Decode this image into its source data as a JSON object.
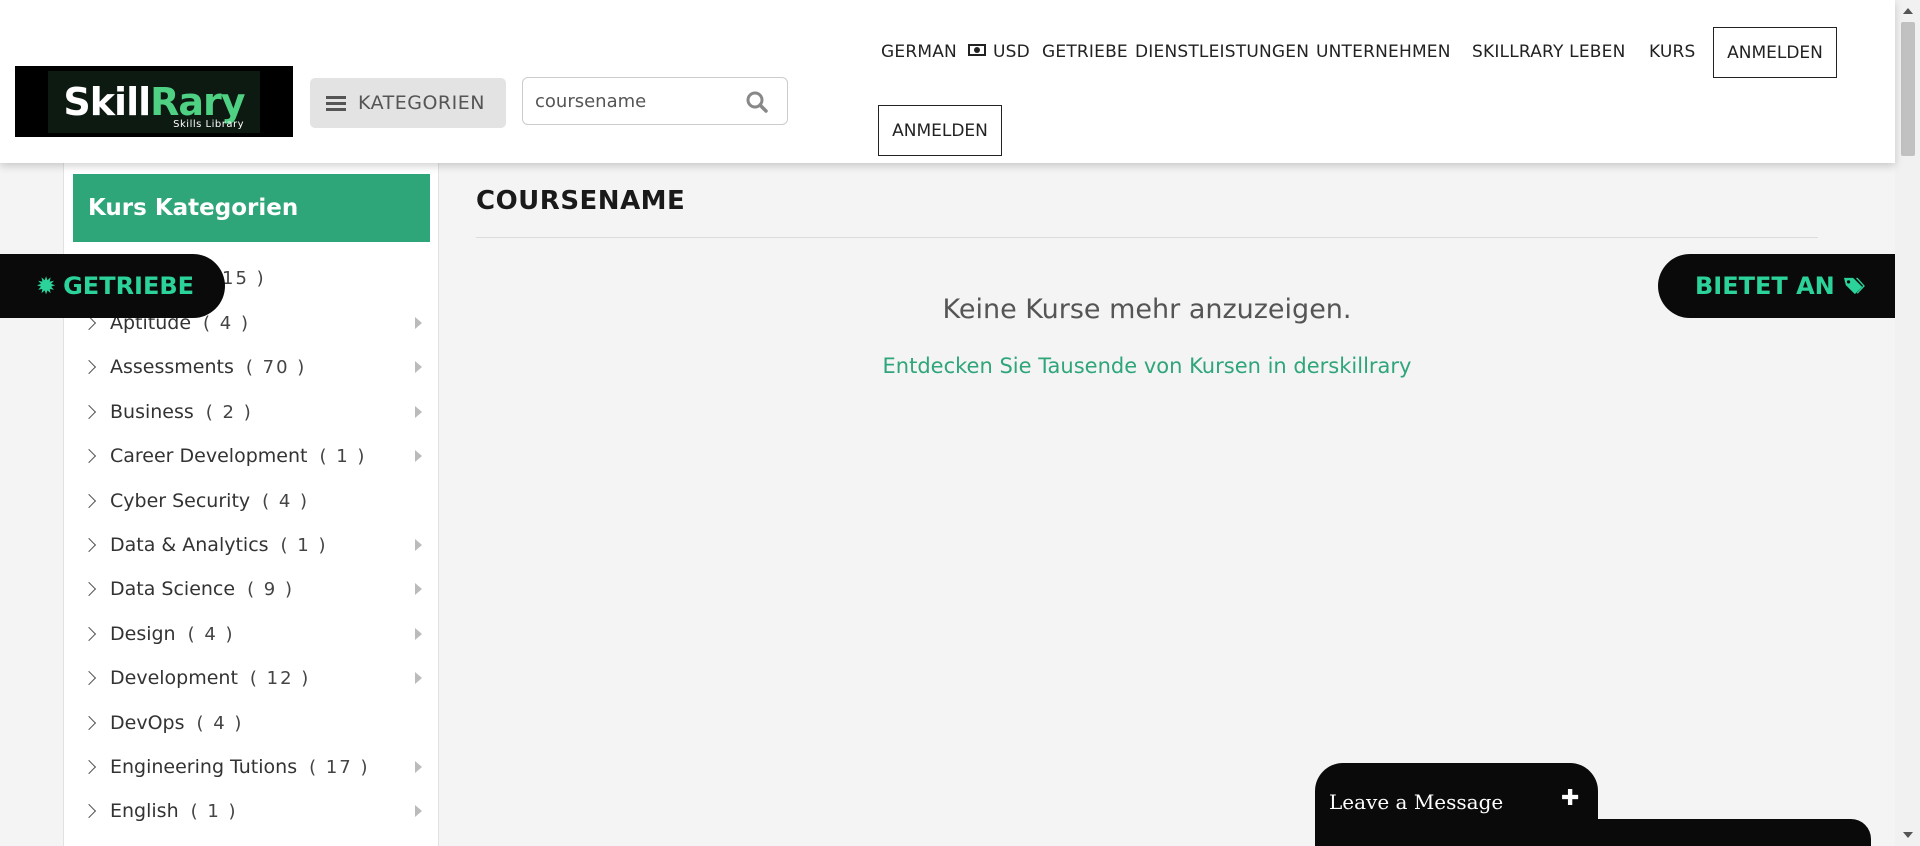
{
  "logo": {
    "text_main_1": "Skill",
    "text_main_2": "Rary",
    "subtitle": "Skills Library"
  },
  "header": {
    "categories_label": "KATEGORIEN",
    "search_value": "coursename",
    "nav": {
      "language": "GERMAN",
      "currency": "USD",
      "gear": "GETRIEBE",
      "services": "DIENSTLEISTUNGEN",
      "company": "UNTERNEHMEN",
      "live": "SKILLRARY LEBEN",
      "course": "KURS",
      "login": "ANMELDEN",
      "login_2": "ANMELDEN"
    }
  },
  "sidebar": {
    "title": "Kurs Kategorien",
    "partial_item_count": "15 )",
    "items": [
      {
        "label": "Aptitude",
        "count": "( 4 )",
        "has_sub": true
      },
      {
        "label": "Assessments",
        "count": "( 70 )",
        "has_sub": true
      },
      {
        "label": "Business",
        "count": "( 2 )",
        "has_sub": true
      },
      {
        "label": "Career Development",
        "count": "( 1 )",
        "has_sub": true
      },
      {
        "label": "Cyber Security",
        "count": "( 4 )",
        "has_sub": false
      },
      {
        "label": "Data & Analytics",
        "count": "( 1 )",
        "has_sub": true
      },
      {
        "label": "Data Science",
        "count": "( 9 )",
        "has_sub": true
      },
      {
        "label": "Design",
        "count": "( 4 )",
        "has_sub": true
      },
      {
        "label": "Development",
        "count": "( 12 )",
        "has_sub": true
      },
      {
        "label": "DevOps",
        "count": "( 4 )",
        "has_sub": false
      },
      {
        "label": "Engineering Tutions",
        "count": "( 17 )",
        "has_sub": true
      },
      {
        "label": "English",
        "count": "( 1 )",
        "has_sub": true
      }
    ]
  },
  "main": {
    "title": "COURSENAME",
    "empty_message": "Keine Kurse mehr anzuzeigen.",
    "discover_link": "Entdecken Sie Tausende von Kursen in derskillrary"
  },
  "floating": {
    "gear_badge": "GETRIEBE",
    "offer_badge": "BIETET AN"
  },
  "chat": {
    "label": "Leave a Message"
  },
  "colors": {
    "accent": "#2fa57a",
    "badge_text": "#2bd39b",
    "badge_bg": "#0a0a0a"
  },
  "icons": [
    "menu-icon",
    "search-icon",
    "money-icon",
    "chevron-right-icon",
    "caret-right-icon",
    "gear-icon",
    "tag-icon",
    "plus-icon"
  ]
}
